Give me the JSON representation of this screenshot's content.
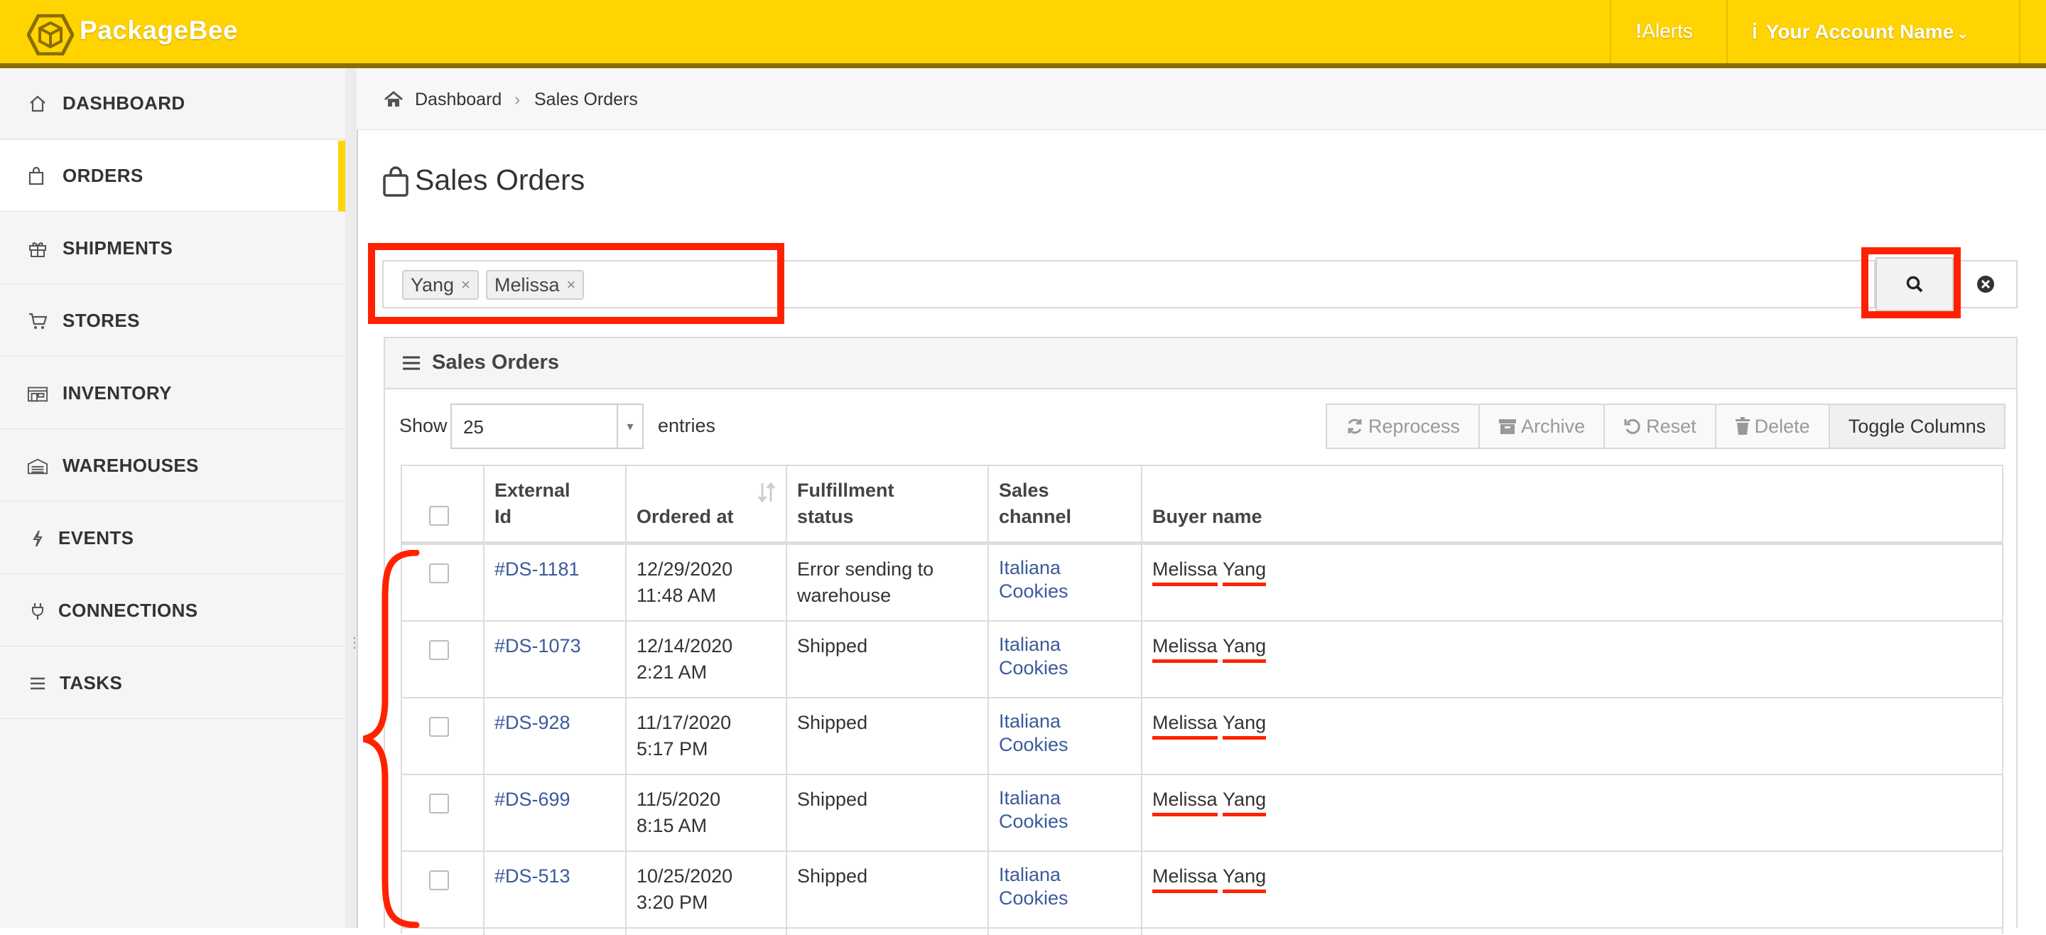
{
  "app": {
    "brand": "PackageBee",
    "alerts_label": "Alerts",
    "account_label": "Your Account Name"
  },
  "sidebar": {
    "items": [
      {
        "label": "DASHBOARD",
        "icon": "home-icon"
      },
      {
        "label": "ORDERS",
        "icon": "shopping-bag-icon",
        "active": true
      },
      {
        "label": "SHIPMENTS",
        "icon": "gift-icon"
      },
      {
        "label": "STORES",
        "icon": "cart-icon"
      },
      {
        "label": "INVENTORY",
        "icon": "warehouse-icon"
      },
      {
        "label": "WAREHOUSES",
        "icon": "building-icon"
      },
      {
        "label": "EVENTS",
        "icon": "bolt-icon"
      },
      {
        "label": "CONNECTIONS",
        "icon": "plug-icon"
      },
      {
        "label": "TASKS",
        "icon": "list-icon"
      }
    ]
  },
  "breadcrumb": {
    "home": "Dashboard",
    "current": "Sales Orders"
  },
  "page": {
    "title": "Sales Orders"
  },
  "search": {
    "chips": [
      "Yang",
      "Melissa"
    ]
  },
  "panel": {
    "title": "Sales Orders",
    "show_label": "Show",
    "entries_value": "25",
    "entries_label": "entries",
    "buttons": [
      "Reprocess",
      "Archive",
      "Reset",
      "Delete",
      "Toggle Columns"
    ]
  },
  "table": {
    "headers": {
      "external_id": [
        "External",
        "Id"
      ],
      "ordered_at": "Ordered at",
      "fulfillment": [
        "Fulfillment",
        "status"
      ],
      "channel": [
        "Sales",
        "channel"
      ],
      "buyer": "Buyer name"
    },
    "rows": [
      {
        "id": "#DS-1181",
        "date": "12/29/2020",
        "time": "11:48 AM",
        "status": [
          "Error sending to",
          "warehouse"
        ],
        "channel": [
          "Italiana",
          "Cookies"
        ],
        "first": "Melissa",
        "last": "Yang"
      },
      {
        "id": "#DS-1073",
        "date": "12/14/2020",
        "time": "2:21 AM",
        "status": [
          "Shipped",
          ""
        ],
        "channel": [
          "Italiana",
          "Cookies"
        ],
        "first": "Melissa",
        "last": "Yang"
      },
      {
        "id": "#DS-928",
        "date": "11/17/2020",
        "time": "5:17 PM",
        "status": [
          "Shipped",
          ""
        ],
        "channel": [
          "Italiana",
          "Cookies"
        ],
        "first": "Melissa",
        "last": "Yang"
      },
      {
        "id": "#DS-699",
        "date": "11/5/2020",
        "time": "8:15 AM",
        "status": [
          "Shipped",
          ""
        ],
        "channel": [
          "Italiana",
          "Cookies"
        ],
        "first": "Melissa",
        "last": "Yang"
      },
      {
        "id": "#DS-513",
        "date": "10/25/2020",
        "time": "3:20 PM",
        "status": [
          "Shipped",
          ""
        ],
        "channel": [
          "Italiana",
          "Cookies"
        ],
        "first": "Melissa",
        "last": "Yang"
      }
    ]
  },
  "colors": {
    "brand_yellow": "#ffd400",
    "link_blue": "#3b5a9a",
    "annotation_red": "#ff2200"
  }
}
